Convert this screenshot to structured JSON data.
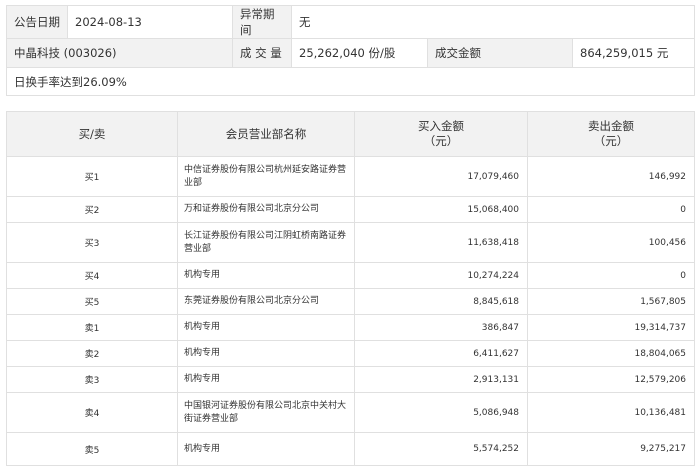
{
  "info": {
    "date_label": "公告日期",
    "date_value": "2024-08-13",
    "period_label": "异常期间",
    "period_value": "无",
    "stock_name": "中晶科技 (003026)",
    "volume_label": "成 交 量",
    "volume_value": "25,262,040 份/股",
    "amount_label": "成交金额",
    "amount_value": "864,259,015 元",
    "turnover_text": "日换手率达到26.09%"
  },
  "table": {
    "headers": {
      "side": "买/卖",
      "broker": "会员营业部名称",
      "buy_line1": "买入金额",
      "buy_line2": "（元）",
      "sell_line1": "卖出金额",
      "sell_line2": "（元）"
    },
    "rows": [
      {
        "side": "买1",
        "broker": "中信证券股份有限公司杭州延安路证券营业部",
        "buy": "17,079,460",
        "sell": "146,992"
      },
      {
        "side": "买2",
        "broker": "万和证券股份有限公司北京分公司",
        "buy": "15,068,400",
        "sell": "0"
      },
      {
        "side": "买3",
        "broker": "长江证券股份有限公司江阴虹桥南路证券营业部",
        "buy": "11,638,418",
        "sell": "100,456"
      },
      {
        "side": "买4",
        "broker": "机构专用",
        "buy": "10,274,224",
        "sell": "0"
      },
      {
        "side": "买5",
        "broker": "东莞证券股份有限公司北京分公司",
        "buy": "8,845,618",
        "sell": "1,567,805"
      },
      {
        "side": "卖1",
        "broker": "机构专用",
        "buy": "386,847",
        "sell": "19,314,737"
      },
      {
        "side": "卖2",
        "broker": "机构专用",
        "buy": "6,411,627",
        "sell": "18,804,065"
      },
      {
        "side": "卖3",
        "broker": "机构专用",
        "buy": "2,913,131",
        "sell": "12,579,206"
      },
      {
        "side": "卖4",
        "broker": "中国银河证券股份有限公司北京中关村大街证券营业部",
        "buy": "5,086,948",
        "sell": "10,136,481"
      },
      {
        "side": "卖5",
        "broker": "机构专用",
        "buy": "5,574,252",
        "sell": "9,275,217"
      }
    ]
  }
}
